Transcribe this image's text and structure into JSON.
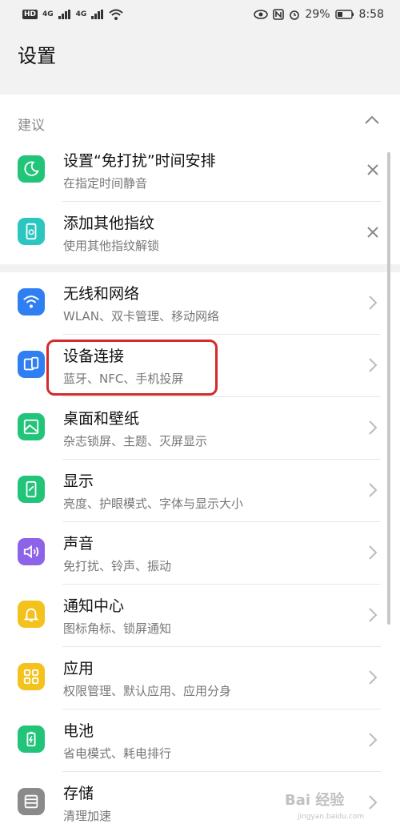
{
  "status_bar": {
    "left_badge": "HD",
    "sim1": "4G",
    "sim2": "4G",
    "battery_percent": "29%",
    "time": "8:58"
  },
  "page_title": "设置",
  "suggestions": {
    "label": "建议",
    "items": [
      {
        "title": "设置“免打扰”时间安排",
        "subtitle": "在指定时间静音",
        "icon": "moon-icon",
        "color": "#22c47a"
      },
      {
        "title": "添加其他指纹",
        "subtitle": "使用其他指纹解锁",
        "icon": "fingerprint-phone-icon",
        "color": "#2cc6c0"
      }
    ]
  },
  "settings": {
    "items": [
      {
        "title": "无线和网络",
        "subtitle": "WLAN、双卡管理、移动网络",
        "icon": "wifi-icon",
        "color": "#2f7ef2"
      },
      {
        "title": "设备连接",
        "subtitle": "蓝牙、NFC、手机投屏",
        "icon": "device-connect-icon",
        "color": "#2f7ef2"
      },
      {
        "title": "桌面和壁纸",
        "subtitle": "杂志锁屏、主题、灭屏显示",
        "icon": "wallpaper-icon",
        "color": "#22c47a"
      },
      {
        "title": "显示",
        "subtitle": "亮度、护眼模式、字体与显示大小",
        "icon": "display-icon",
        "color": "#22c47a"
      },
      {
        "title": "声音",
        "subtitle": "免打扰、铃声、振动",
        "icon": "speaker-icon",
        "color": "#8d63e8"
      },
      {
        "title": "通知中心",
        "subtitle": "图标角标、锁屏通知",
        "icon": "bell-icon",
        "color": "#f4c21c"
      },
      {
        "title": "应用",
        "subtitle": "权限管理、默认应用、应用分身",
        "icon": "apps-grid-icon",
        "color": "#f4c21c"
      },
      {
        "title": "电池",
        "subtitle": "省电模式、耗电排行",
        "icon": "battery-icon",
        "color": "#22c47a"
      },
      {
        "title": "存储",
        "subtitle": "清理加速",
        "icon": "storage-icon",
        "color": "#8a8a8a"
      }
    ]
  },
  "watermark": {
    "text": "Bai 经验",
    "sub": "jingyan.baidu.com"
  }
}
